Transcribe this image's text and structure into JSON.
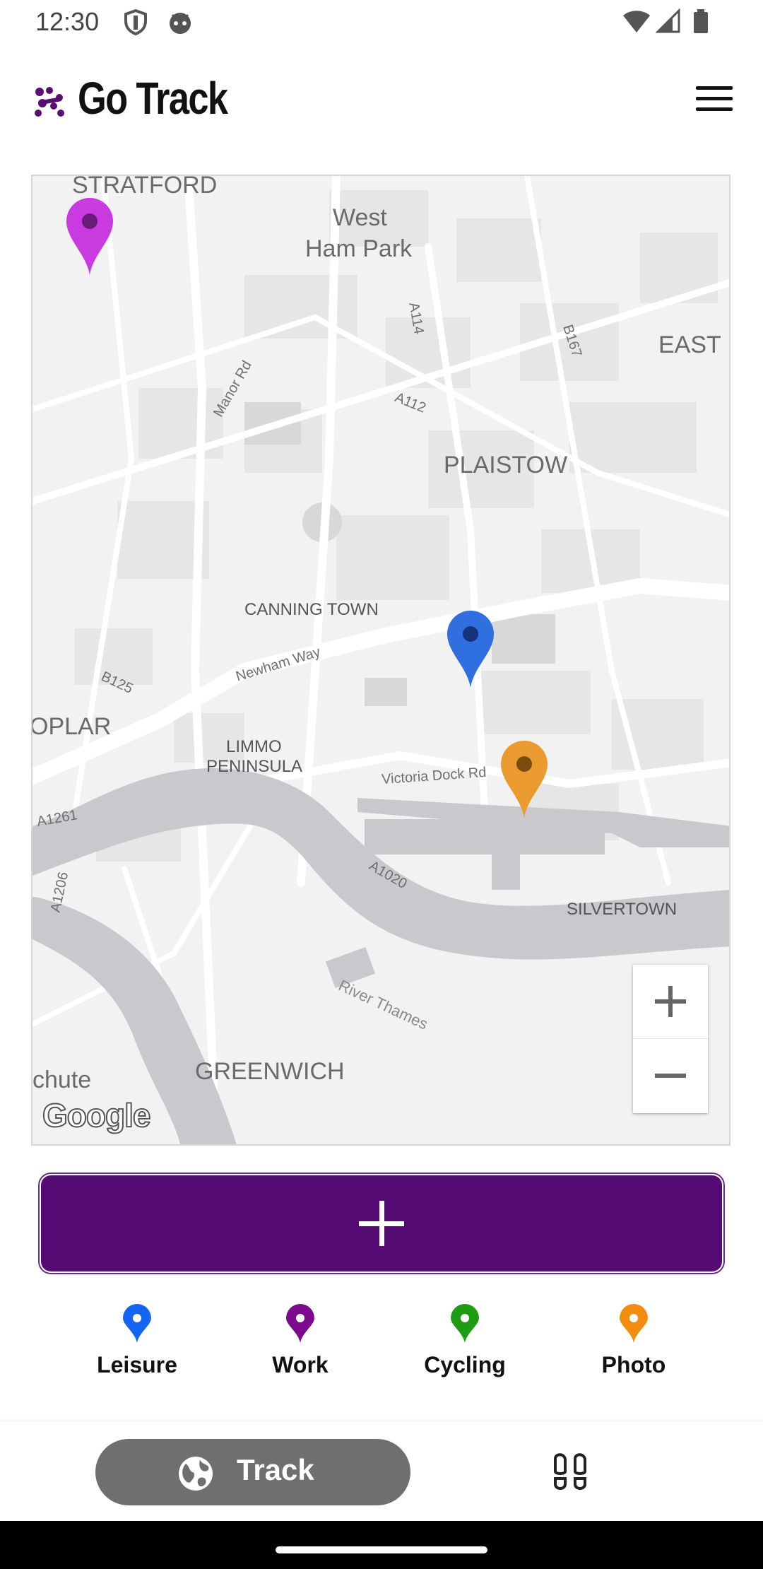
{
  "status_bar": {
    "time": "12:30"
  },
  "header": {
    "title": "Go Track"
  },
  "map": {
    "labels": {
      "stratford": "STRATFORD",
      "west_ham_park_1": "West",
      "west_ham_park_2": "Ham Park",
      "a114": "A114",
      "b167": "B167",
      "east": "EAST",
      "manor_rd": "Manor Rd",
      "a112": "A112",
      "plaistow": "PLAISTOW",
      "canning_town": "CANNING TOWN",
      "newham_way": "Newham Way",
      "b125": "B125",
      "poplar": "OPLAR",
      "limmo_1": "LIMMO",
      "limmo_2": "PENINSULA",
      "victoria_dock": "Victoria Dock Rd",
      "a1261": "A1261",
      "a1206": "A1206",
      "a1020": "A1020",
      "silvertown": "SILVERTOWN",
      "river_thames": "River Thames",
      "chute": "chute",
      "greenwich": "GREENWICH"
    },
    "attribution": "Google",
    "markers": [
      {
        "category": "Work",
        "color": "#c93ae0"
      },
      {
        "category": "Leisure",
        "color": "#2f6fe0"
      },
      {
        "category": "Photo",
        "color": "#eb9a30"
      }
    ]
  },
  "add_button": {
    "icon": "plus-icon",
    "color": "#540b73"
  },
  "legend": [
    {
      "label": "Leisure",
      "color": "#1565f5"
    },
    {
      "label": "Work",
      "color": "#7d0a8c"
    },
    {
      "label": "Cycling",
      "color": "#1e9c14"
    },
    {
      "label": "Photo",
      "color": "#f28c0f"
    }
  ],
  "bottom_nav": {
    "track_label": "Track",
    "track_icon": "globe-icon",
    "second_icon": "footprints-icon"
  }
}
